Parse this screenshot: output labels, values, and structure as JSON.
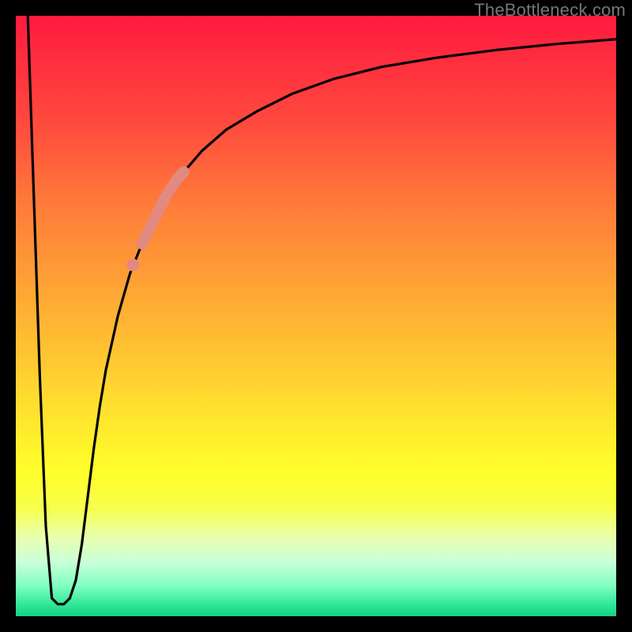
{
  "watermark": "TheBottleneck.com",
  "chart_data": {
    "type": "line",
    "title": "",
    "xlabel": "",
    "ylabel": "",
    "xlim": [
      0,
      100
    ],
    "ylim": [
      0,
      100
    ],
    "grid": false,
    "legend": false,
    "series": [
      {
        "name": "bottleneck-curve",
        "color": "#000000",
        "x": [
          2,
          3,
          4,
          5,
          6,
          7,
          8,
          9,
          10,
          11,
          12,
          13,
          14,
          15,
          17,
          19,
          21,
          23,
          25,
          28,
          31,
          35,
          40,
          46,
          53,
          61,
          70,
          80,
          90,
          100
        ],
        "y": [
          100,
          70,
          40,
          15,
          3,
          2,
          2,
          3,
          6,
          12,
          20,
          28,
          35,
          41,
          50,
          57,
          62,
          66,
          70,
          74,
          77.5,
          81,
          84,
          87,
          89.5,
          91.5,
          93,
          94.3,
          95.3,
          96.1
        ]
      },
      {
        "name": "highlight-segment",
        "color": "#e28a82",
        "x": [
          21,
          22,
          23,
          24,
          25,
          26,
          27,
          28
        ],
        "y": [
          62,
          64,
          66,
          68,
          70,
          71.5,
          73,
          74
        ]
      },
      {
        "name": "highlight-dot-lower",
        "color": "#e28a82",
        "x": [
          19.5
        ],
        "y": [
          58.5
        ]
      }
    ],
    "background_gradient": {
      "top": "#ff1a3f",
      "mid": "#ffe22e",
      "bottom": "#18d084"
    }
  }
}
